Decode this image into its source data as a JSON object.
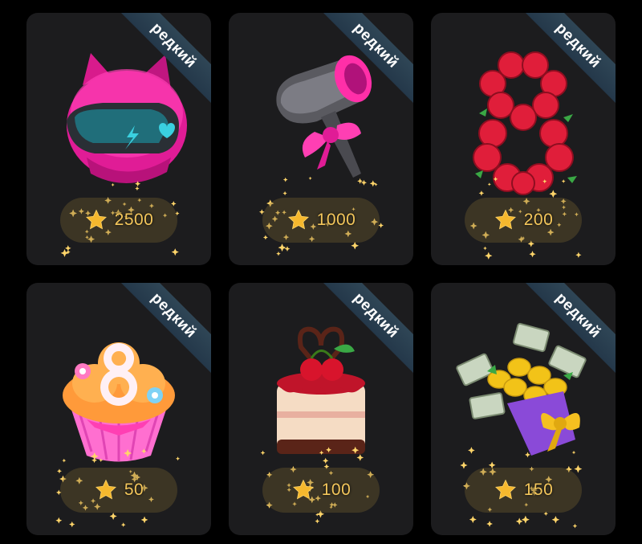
{
  "cards": [
    {
      "badge": "редкий",
      "price": "2500",
      "item_icon": "pink-cat-helmet-icon"
    },
    {
      "badge": "редкий",
      "price": "1000",
      "item_icon": "hair-dryer-bow-icon"
    },
    {
      "badge": "редкий",
      "price": "200",
      "item_icon": "roses-number-eight-icon"
    },
    {
      "badge": "редкий",
      "price": "50",
      "item_icon": "cupcake-eight-icon"
    },
    {
      "badge": "редкий",
      "price": "100",
      "item_icon": "cherry-cake-icon"
    },
    {
      "badge": "редкий",
      "price": "150",
      "item_icon": "money-lemon-bouquet-icon"
    }
  ],
  "colors": {
    "card_bg": "#1c1c1e",
    "ribbon": "#2f4656",
    "price_text": "#f3c65b",
    "price_pill": "#5a4a26"
  }
}
